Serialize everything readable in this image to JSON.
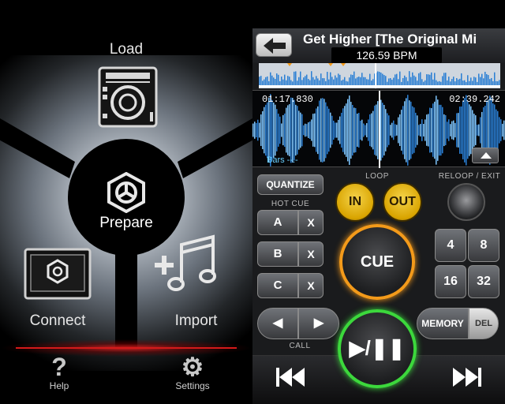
{
  "left_screen": {
    "load_label": "Load",
    "prepare_label": "Prepare",
    "connect_label": "Connect",
    "import_label": "Import",
    "help_label": "Help",
    "settings_label": "Settings",
    "help_icon": "question-mark-icon",
    "settings_icon": "gear-icon"
  },
  "right_screen": {
    "track_title": "Get Higher [The Original Mi",
    "bpm": "126.59 BPM",
    "time_elapsed": "01:17.830",
    "time_remaining": "02:39.242",
    "bars": "Bars --.-",
    "quantize_label": "QUANTIZE",
    "loop_label": "LOOP",
    "loop_in_label": "IN",
    "loop_out_label": "OUT",
    "reloop_label": "RELOOP / EXIT",
    "hot_cue_label": "HOT CUE",
    "hot_cues": [
      {
        "letter": "A",
        "delete": "X"
      },
      {
        "letter": "B",
        "delete": "X"
      },
      {
        "letter": "C",
        "delete": "X"
      }
    ],
    "cue_label": "CUE",
    "loop_lengths": [
      "4",
      "8",
      "16",
      "32"
    ],
    "call_label": "CALL",
    "memory_label": "MEMORY",
    "del_label": "DEL",
    "play_label": "▶/❚❚",
    "colors": {
      "cue_ring": "#f39a1a",
      "play_ring": "#3cd83c",
      "loop_button": "#e0b010",
      "waveform": "#2a7fd4"
    }
  }
}
